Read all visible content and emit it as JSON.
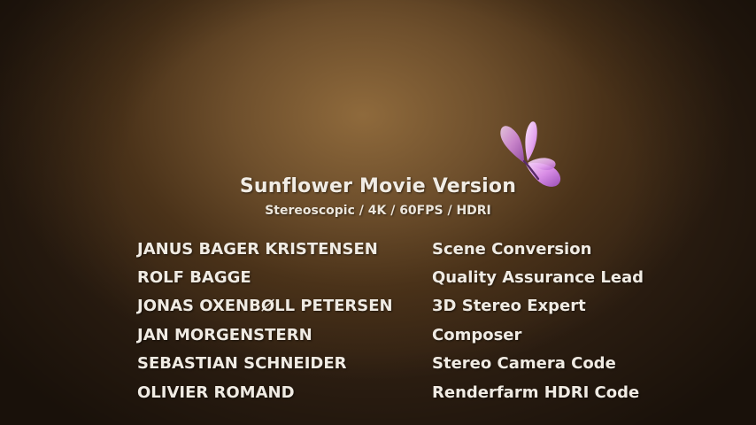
{
  "title": "Sunflower Movie Version",
  "subtitle": "Stereoscopic / 4K / 60FPS / HDRI",
  "credits": [
    {
      "name": "JANUS BAGER KRISTENSEN",
      "role": "Scene Conversion"
    },
    {
      "name": "ROLF BAGGE",
      "role": "Quality Assurance Lead"
    },
    {
      "name": "JONAS OXENBØLL PETERSEN",
      "role": "3D Stereo Expert"
    },
    {
      "name": "JAN MORGENSTERN",
      "role": "Composer"
    },
    {
      "name": "SEBASTIAN SCHNEIDER",
      "role": "Stereo Camera Code"
    },
    {
      "name": "OLIVIER ROMAND",
      "role": "Renderfarm HDRI Code"
    }
  ],
  "colors": {
    "background": "#6e4f2c",
    "text": "#f0ebe3",
    "butterfly": "#d98ee6"
  },
  "icons": {
    "butterfly": "butterfly-icon"
  }
}
